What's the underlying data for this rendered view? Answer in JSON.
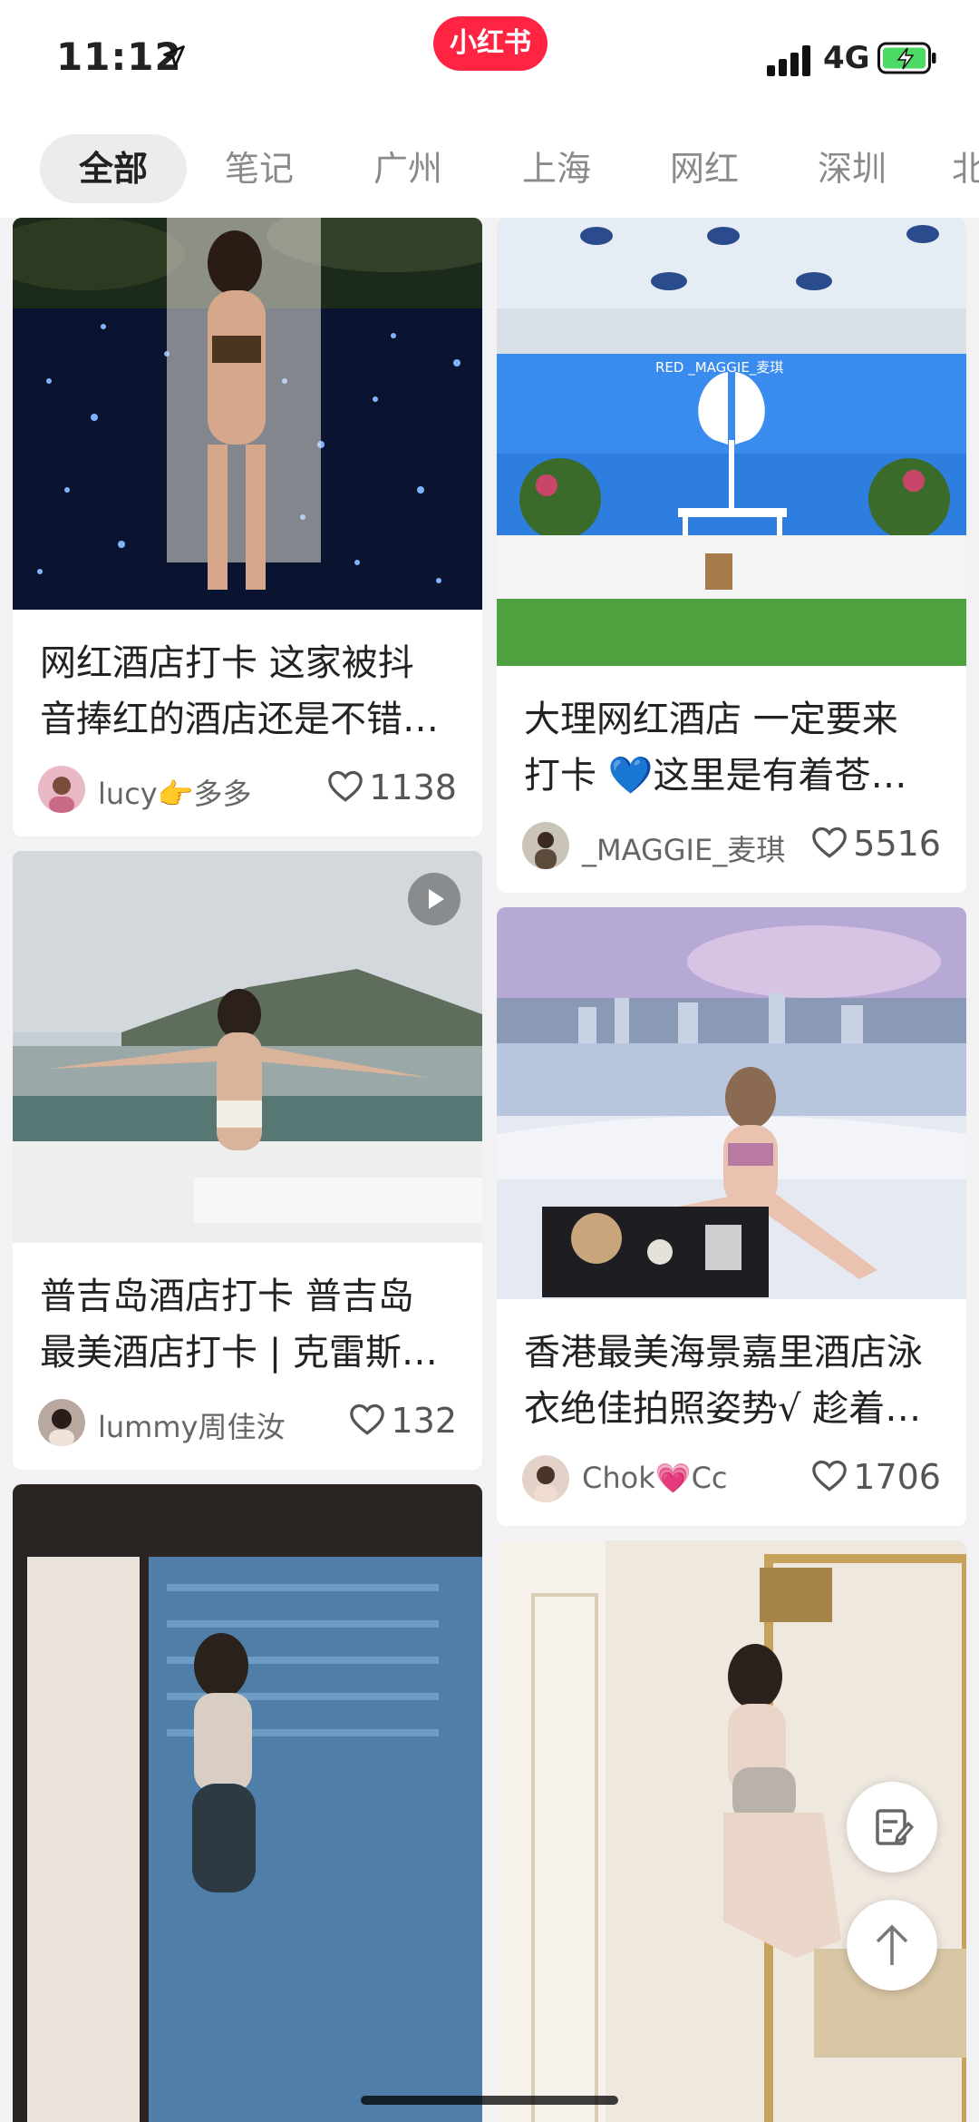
{
  "status_bar": {
    "time": "11:12",
    "network": "4G",
    "app_logo_text": "小红书"
  },
  "tabs": [
    {
      "label": "全部",
      "active": true
    },
    {
      "label": "笔记"
    },
    {
      "label": "广州"
    },
    {
      "label": "上海"
    },
    {
      "label": "网红"
    },
    {
      "label": "深圳"
    },
    {
      "label": "北"
    }
  ],
  "feed": [
    {
      "title_line1": "网红酒店打卡 这家被抖",
      "title_line2": "音捧红的酒店还是不错…",
      "author": "lucy👉多多",
      "likes": "1138",
      "video": false
    },
    {
      "title_line1": "大理网红酒店 一定要来",
      "title_line2": "打卡 💙这里是有着苍…",
      "author": "_MAGGIE_麦琪",
      "likes": "5516",
      "watermark": "RED _MAGGIE_麦琪",
      "video": false
    },
    {
      "title_line1": "普吉岛酒店打卡 普吉岛",
      "title_line2": "最美酒店打卡 | 克雷斯…",
      "author": "lummy周佳汝",
      "likes": "132",
      "video": true
    },
    {
      "title_line1": "香港最美海景嘉里酒店泳",
      "title_line2": "衣绝佳拍照姿势√ 趁着…",
      "author": "Chok💗Cc",
      "likes": "1706",
      "video": false
    },
    {
      "title_line1": "",
      "author": "",
      "likes": ""
    },
    {
      "title_line1": "",
      "author": "",
      "likes": ""
    }
  ],
  "icons": {
    "location": "location-arrow-icon",
    "signal": "signal-icon",
    "battery": "battery-charging-icon",
    "heart": "heart-outline-icon",
    "play": "play-icon",
    "compose": "compose-icon",
    "back_to_top": "arrow-up-icon"
  },
  "colors": {
    "brand": "#ff2442",
    "battery": "#4cd964"
  }
}
